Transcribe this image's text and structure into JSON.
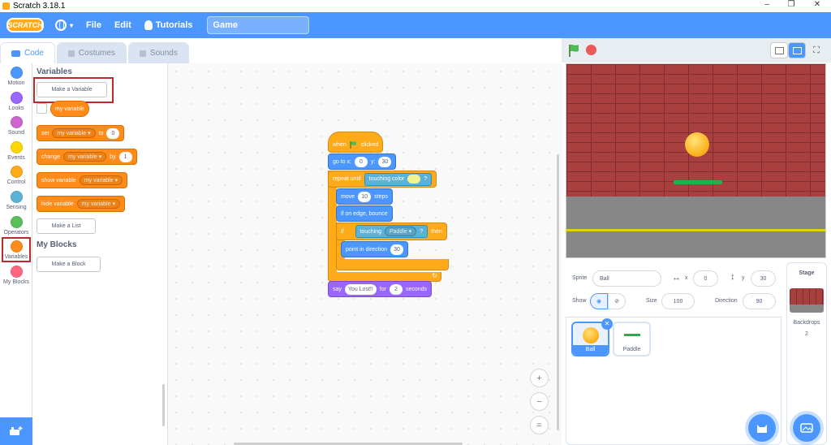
{
  "window": {
    "title": "Scratch 3.18.1",
    "minimize": "–",
    "restore": "❐",
    "close": "✕"
  },
  "menubar": {
    "logo": "SCRATCH",
    "language_icon": "globe-icon",
    "file": "File",
    "edit": "Edit",
    "tutorials": "Tutorials",
    "project_title": "Game"
  },
  "tabs": {
    "code": "Code",
    "costumes": "Costumes",
    "sounds": "Sounds"
  },
  "categories": [
    {
      "label": "Motion",
      "color": "#4c97ff"
    },
    {
      "label": "Looks",
      "color": "#9966ff"
    },
    {
      "label": "Sound",
      "color": "#cf63cf"
    },
    {
      "label": "Events",
      "color": "#ffd500"
    },
    {
      "label": "Control",
      "color": "#ffab19"
    },
    {
      "label": "Sensing",
      "color": "#5cb1d6"
    },
    {
      "label": "Operators",
      "color": "#59c059"
    },
    {
      "label": "Variables",
      "color": "#ff8c1a"
    },
    {
      "label": "My Blocks",
      "color": "#ff6680"
    }
  ],
  "palette": {
    "variables_heading": "Variables",
    "make_variable": "Make a Variable",
    "my_variable": "my variable",
    "set": {
      "label": "set",
      "var": "my variable ▾",
      "to": "to",
      "value": "0"
    },
    "change": {
      "label": "change",
      "var": "my variable ▾",
      "by": "by",
      "value": "1"
    },
    "show": {
      "label": "show variable",
      "var": "my variable ▾"
    },
    "hide": {
      "label": "hide variable",
      "var": "my variable ▾"
    },
    "make_list": "Make a List",
    "myblocks_heading": "My Blocks",
    "make_block": "Make a Block"
  },
  "script": {
    "when": "when",
    "clicked": "clicked",
    "goto": {
      "label": "go to x:",
      "x": "0",
      "y_label": "y:",
      "y": "30"
    },
    "repeat_until": "repeat until",
    "touching_color": "touching color",
    "q": "?",
    "move": {
      "label": "move",
      "value": "10",
      "unit": "steps"
    },
    "bounce": "if on edge, bounce",
    "if": "if",
    "touching": "touching",
    "paddle": "Paddle ▾",
    "then": "then",
    "point": {
      "label": "point in direction",
      "value": "30"
    },
    "say": {
      "label": "say",
      "text": "You Lost!!",
      "for": "for",
      "secs": "2",
      "unit": "seconds"
    }
  },
  "zoom": {
    "in": "+",
    "out": "−",
    "reset": "="
  },
  "sprite_info": {
    "sprite_label": "Sprite",
    "sprite_name": "Ball",
    "x_label": "x",
    "x": "0",
    "y_label": "y",
    "y": "30",
    "show_label": "Show",
    "size_label": "Size",
    "size": "100",
    "direction_label": "Direction",
    "direction": "90"
  },
  "sprites": [
    {
      "name": "Ball"
    },
    {
      "name": "Paddle"
    }
  ],
  "stage_panel": {
    "title": "Stage",
    "backdrops_label": "Backdrops",
    "backdrops_count": "2"
  }
}
